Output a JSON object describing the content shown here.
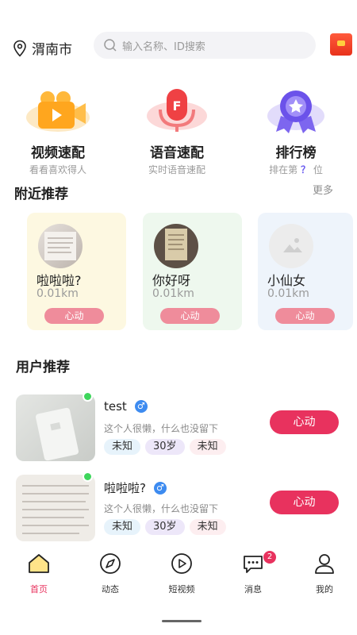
{
  "header": {
    "city": "渭南市",
    "search_placeholder": "输入名称、ID搜索"
  },
  "quick_entries": [
    {
      "title": "视频速配",
      "subtitle": "看看喜欢得人"
    },
    {
      "title": "语音速配",
      "subtitle": "实时语音速配"
    },
    {
      "title": "排行榜",
      "subtitle_pre": "排在第",
      "subtitle_mark": "？",
      "subtitle_post": "位"
    }
  ],
  "nearby": {
    "title": "附近推荐",
    "more": "更多",
    "cards": [
      {
        "name": "啦啦啦?",
        "distance": "0.01km",
        "button": "心动"
      },
      {
        "name": "你好呀",
        "distance": "0.01km",
        "button": "心动"
      },
      {
        "name": "小仙女",
        "distance": "0.01km",
        "button": "心动"
      }
    ]
  },
  "users": {
    "title": "用户推荐",
    "items": [
      {
        "name": "test",
        "gender": "♂",
        "bio": "这个人很懒，什么也没留下",
        "tags": [
          "未知",
          "30岁",
          "未知"
        ],
        "button": "心动"
      },
      {
        "name": "啦啦啦?",
        "gender": "♂",
        "bio": "这个人很懒，什么也没留下",
        "tags": [
          "未知",
          "30岁",
          "未知"
        ],
        "button": "心动"
      }
    ]
  },
  "nav": {
    "items": [
      {
        "label": "首页",
        "active": true
      },
      {
        "label": "动态"
      },
      {
        "label": "短视频"
      },
      {
        "label": "消息",
        "badge": "2"
      },
      {
        "label": "我的"
      }
    ]
  },
  "colors": {
    "accent": "#e8325e",
    "heart_button_soft": "#ef8c9b",
    "online": "#3ed65c",
    "gender_male": "#3d8bf0"
  }
}
